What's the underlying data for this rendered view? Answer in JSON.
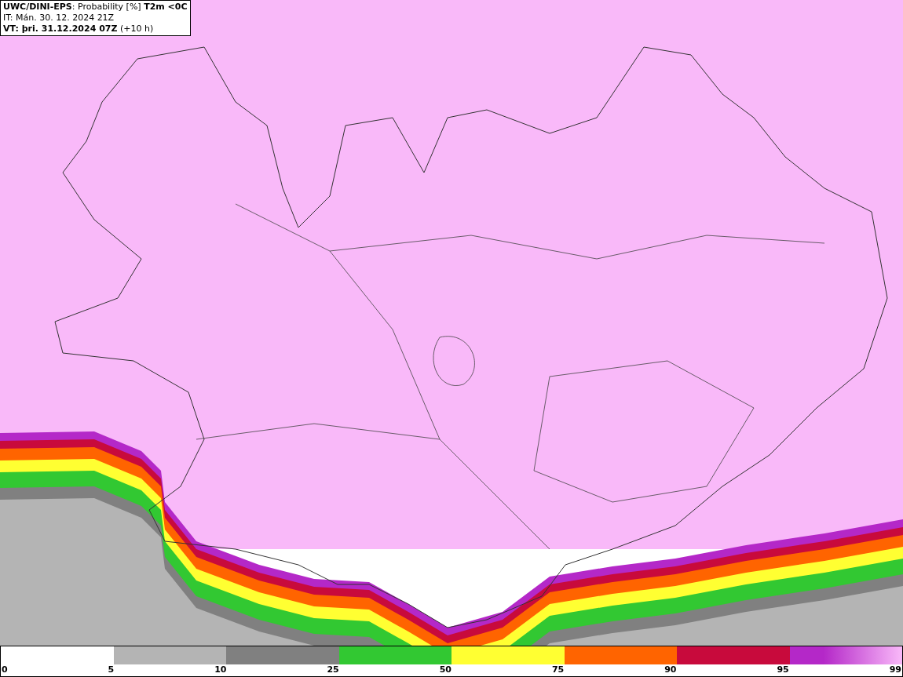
{
  "header": {
    "lines": [
      "**UWC/DINI-EPS**: Probability [%] **T2m <0C**",
      "IT: Mán. 30. 12. 2024 21Z",
      "**VT: þri. 31.12.2024 07Z** (+10 h)"
    ]
  },
  "legend": {
    "bins": [
      {
        "color": "#b4b4b4"
      },
      {
        "color": "#808080"
      },
      {
        "color": "#32c832"
      },
      {
        "color": "#ffff32"
      },
      {
        "color": "#ff6400"
      },
      {
        "color": "#c80a3c"
      },
      {
        "color": "#b428c8"
      }
    ],
    "ticks": [
      "0",
      "5",
      "10",
      "25",
      "50",
      "75",
      "90",
      "95",
      "99"
    ]
  }
}
